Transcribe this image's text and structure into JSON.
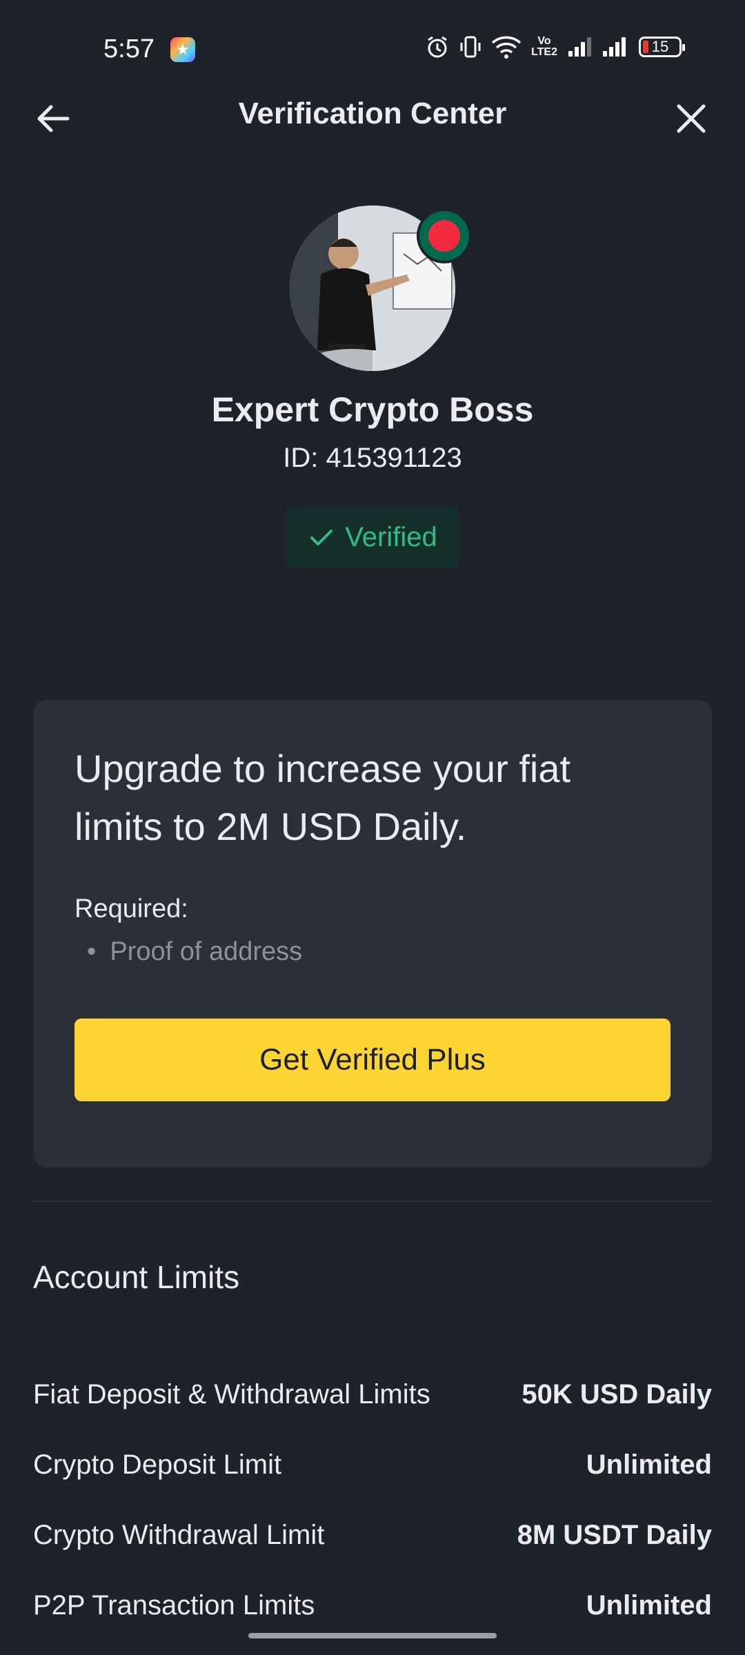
{
  "status_bar": {
    "time": "5:57",
    "battery_percent": "15",
    "icons": [
      "alarm-icon",
      "vibrate-icon",
      "wifi-icon",
      "volte-icon",
      "signal-icon",
      "signal-icon",
      "battery-icon"
    ],
    "volte_label": "Vo LTE2"
  },
  "header": {
    "title": "Verification Center",
    "back_icon": "arrow-left-icon",
    "close_icon": "close-icon"
  },
  "profile": {
    "name": "Expert Crypto Boss",
    "id_text": "ID: 415391123",
    "flag_icon": "bangladesh-flag-icon",
    "verified_label": "Verified"
  },
  "upgrade_card": {
    "title": "Upgrade to increase your fiat limits to 2M USD Daily.",
    "required_label": "Required:",
    "required_items": [
      "Proof of address"
    ],
    "button_label": "Get Verified Plus"
  },
  "limits": {
    "title": "Account Limits",
    "rows": [
      {
        "label": "Fiat Deposit & Withdrawal Limits",
        "value": "50K USD Daily"
      },
      {
        "label": "Crypto Deposit Limit",
        "value": "Unlimited"
      },
      {
        "label": "Crypto Withdrawal Limit",
        "value": "8M USDT Daily"
      },
      {
        "label": "P2P Transaction Limits",
        "value": "Unlimited"
      }
    ]
  },
  "colors": {
    "background": "#1f2229",
    "card": "#2b2f38",
    "accent_yellow": "#fcd535",
    "verified_green": "#2ebd85"
  }
}
